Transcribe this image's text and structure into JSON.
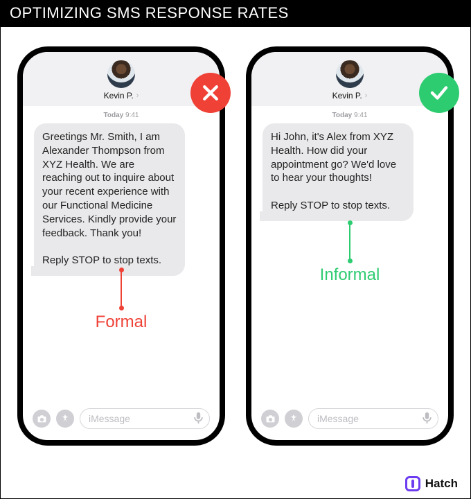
{
  "title": "OPTIMIZING SMS RESPONSE RATES",
  "brand": "Hatch",
  "contact_name": "Kevin P.",
  "timestamp_day": "Today",
  "timestamp_time": "9:41",
  "input_placeholder": "iMessage",
  "left": {
    "style_label": "Formal",
    "message": "Greetings Mr. Smith, I am Alexander Thompson from XYZ Health. We are reaching out to inquire about your recent experience with our Functional Medicine Services. Kindly provide your feedback. Thank you!\n\nReply STOP to stop texts."
  },
  "right": {
    "style_label": "Informal",
    "message": "Hi John, it's Alex from XYZ Health. How did your appointment go? We'd love to hear your thoughts!\n\nReply STOP to stop texts."
  }
}
